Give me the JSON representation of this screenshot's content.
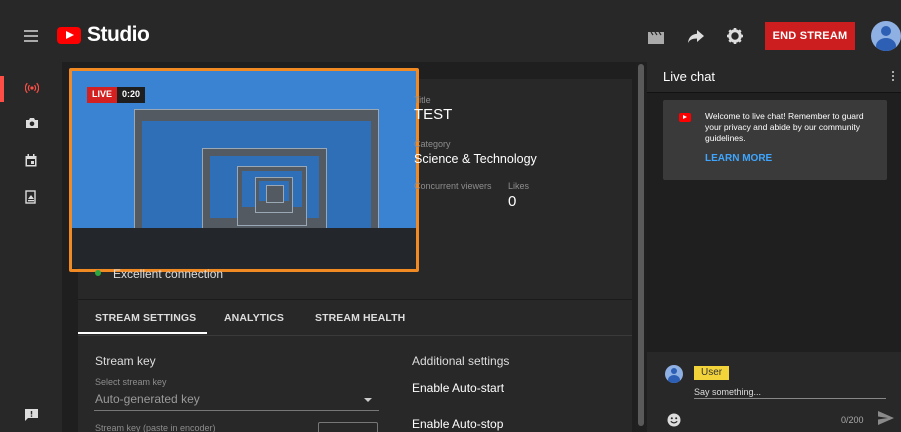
{
  "app": {
    "title": "Studio"
  },
  "header": {
    "end_stream_label": "END STREAM"
  },
  "icons": {
    "menu": "menu-icon",
    "logo": "youtube-logo-icon",
    "clapper": "clapperboard-icon",
    "share": "share-icon",
    "settings": "gear-icon",
    "live": "live-broadcast-icon",
    "camera": "camera-icon",
    "calendar": "calendar-icon",
    "upload": "upload-icon",
    "feedback": "feedback-icon",
    "emoji": "emoji-icon",
    "send": "send-icon"
  },
  "colors": {
    "accent_red": "#cc1e1e",
    "live_red": "#d32020",
    "link_blue": "#3ea6ff",
    "connection_green": "#2ba640",
    "highlight_orange": "#f28a24",
    "user_badge": "#f3d33a"
  },
  "video": {
    "live_label": "LIVE",
    "elapsed": "0:20"
  },
  "stream_info": {
    "title_label": "Title",
    "title": "TEST",
    "category_label": "Category",
    "category": "Science & Technology",
    "viewers_label": "Concurrent viewers",
    "likes_label": "Likes",
    "likes": "0",
    "connection": "Excellent connection"
  },
  "tabs": [
    {
      "label": "STREAM SETTINGS",
      "active": true
    },
    {
      "label": "ANALYTICS",
      "active": false
    },
    {
      "label": "STREAM HEALTH",
      "active": false
    }
  ],
  "stream_settings": {
    "stream_key_title": "Stream key",
    "select_label": "Select stream key",
    "select_value": "Auto-generated key",
    "paste_label": "Stream key (paste in encoder)"
  },
  "additional": {
    "title": "Additional settings",
    "auto_start": "Enable Auto-start",
    "auto_stop": "Enable Auto-stop"
  },
  "chat": {
    "title": "Live chat",
    "welcome": "Welcome to live chat! Remember to guard your privacy and abide by our community guidelines.",
    "learn_more": "LEARN MORE",
    "user_name": "User",
    "placeholder": "Say something...",
    "char_count": "0/200"
  }
}
